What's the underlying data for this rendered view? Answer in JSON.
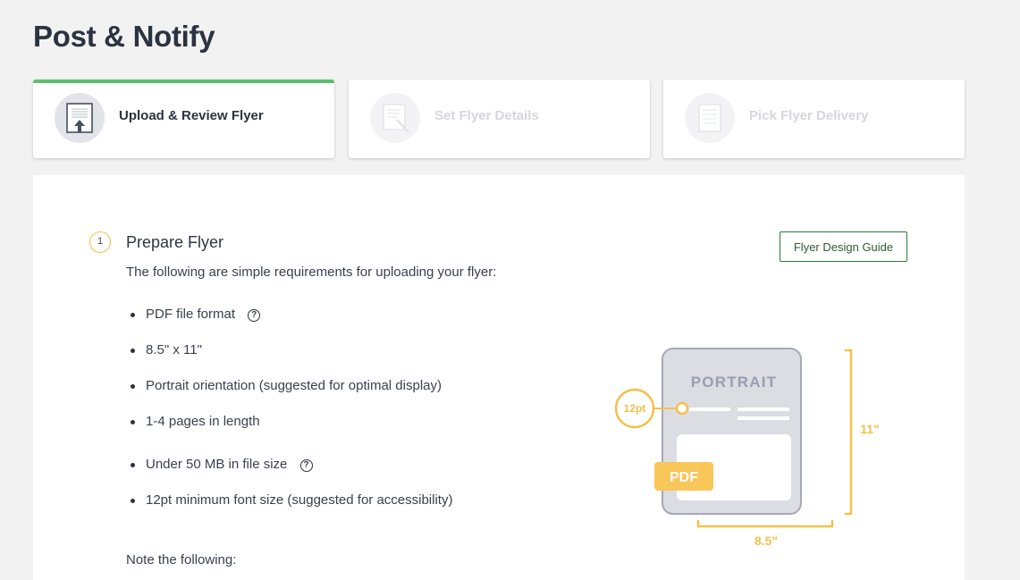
{
  "page": {
    "title": "Post & Notify"
  },
  "steps": [
    {
      "label": "Upload & Review Flyer",
      "state": "active",
      "icon": "upload-document-icon"
    },
    {
      "label": "Set Flyer Details",
      "state": "inactive",
      "icon": "edit-document-icon"
    },
    {
      "label": "Pick Flyer Delivery",
      "state": "inactive",
      "icon": "document-list-icon"
    }
  ],
  "section": {
    "number": "1",
    "title": "Prepare Flyer",
    "description": "The following are simple requirements for uploading your flyer:",
    "guide_button": "Flyer Design Guide",
    "requirements": [
      {
        "text": "PDF file format",
        "has_help": true
      },
      {
        "text": "8.5\" x 11\"",
        "has_help": false
      },
      {
        "text": "Portrait orientation (suggested for optimal display)",
        "has_help": false
      },
      {
        "text": "1-4 pages in length",
        "has_help": false
      },
      {
        "text": "Under 50 MB in file size",
        "has_help": true
      },
      {
        "text": "12pt minimum font size (suggested for accessibility)",
        "has_help": false
      }
    ],
    "note": "Note the following:"
  },
  "illustration": {
    "orientation_label": "PORTRAIT",
    "font_size_label": "12pt",
    "format_badge": "PDF",
    "height_label": "11\"",
    "width_label": "8.5\""
  },
  "colors": {
    "accent_green": "#5cbf6a",
    "button_green": "#2e7d32",
    "highlight_yellow": "#f5c04a",
    "doc_gray": "#dcdde3"
  },
  "icons": {
    "help": "question-circle-icon"
  }
}
